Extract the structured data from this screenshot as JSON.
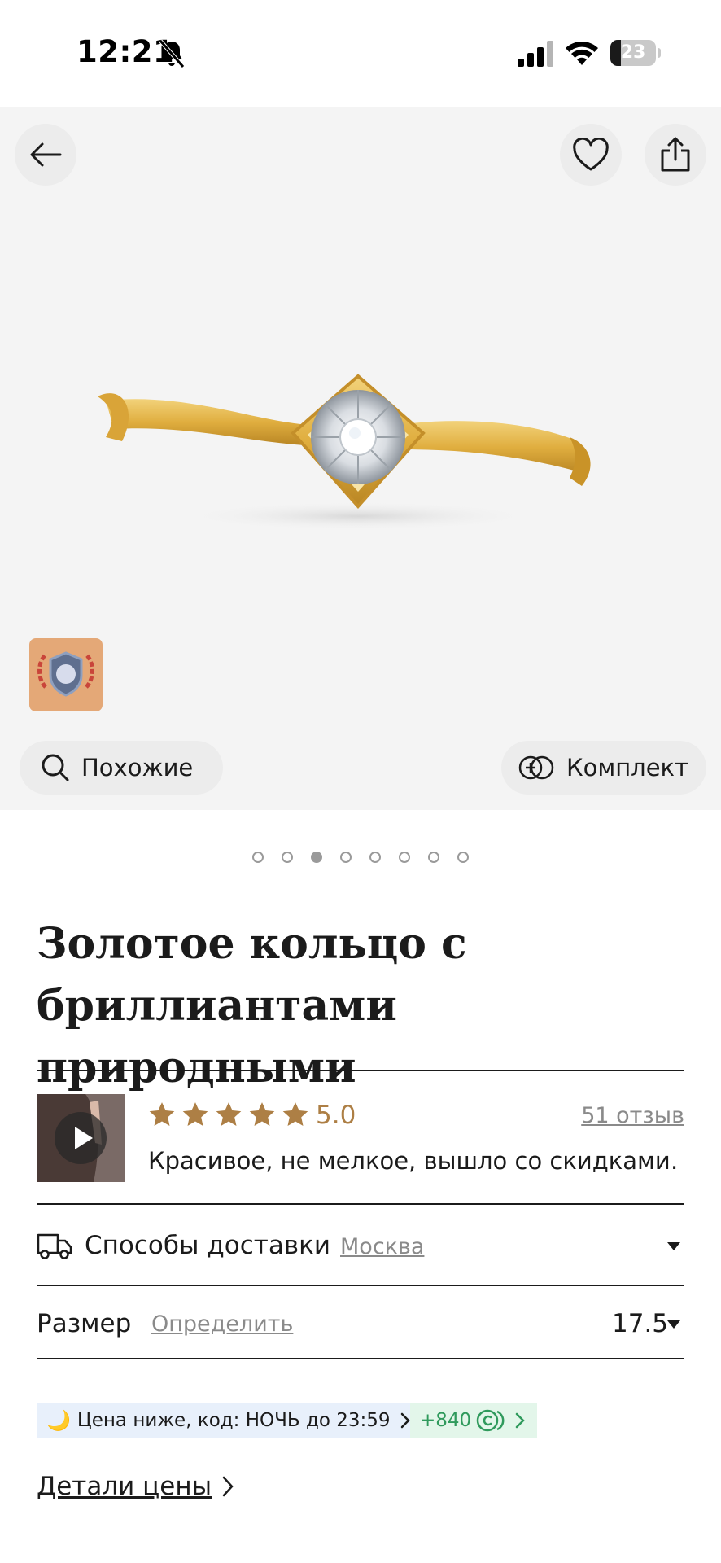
{
  "status_bar": {
    "time": "12:21",
    "battery_level": "23",
    "battery_fraction": 0.23
  },
  "gallery": {
    "back_icon": "arrow-left-icon",
    "favorite_icon": "heart-icon",
    "share_icon": "share-icon",
    "similar_label": "Похожие",
    "set_label": "Комплект",
    "total_images": 8,
    "active_image_index": 2
  },
  "product": {
    "title_line1": "Золотое кольцо с",
    "title_line2": "бриллиантами природными"
  },
  "reviews": {
    "rating": "5.0",
    "stars": 5,
    "count_label": "51 отзыв",
    "excerpt": "Красивое, не мелкое, вышло со скидками…"
  },
  "delivery": {
    "label": "Способы доставки",
    "city": "Москва"
  },
  "size": {
    "label": "Размер",
    "detect_link": "Определить",
    "value": "17.5"
  },
  "promo": {
    "night_text": "Цена ниже, код: НОЧЬ до 23:59",
    "bonus_text": "+840"
  },
  "price_details_label": "Детали цены",
  "colors": {
    "gold_accent": "#ad7f45",
    "bonus_green": "#2f9a5c",
    "promo_blue_bg": "#e8f0fb"
  }
}
